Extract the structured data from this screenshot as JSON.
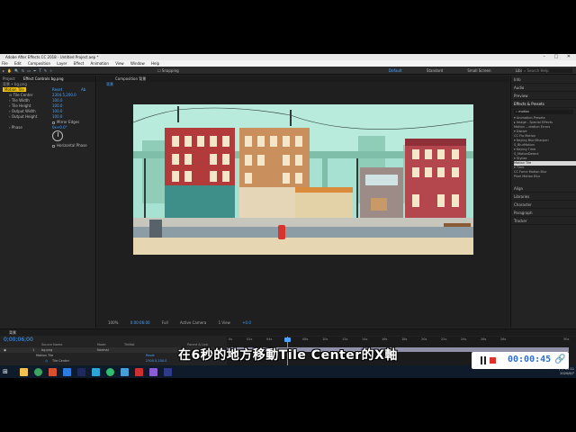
{
  "window": {
    "title": "Adobe After Effects CC 2018 - Untitled Project.aep *",
    "controls": "–  □  ✕"
  },
  "menu": [
    "File",
    "Edit",
    "Composition",
    "Layer",
    "Effect",
    "Animation",
    "View",
    "Window",
    "Help"
  ],
  "toolbar": {
    "snapping": "Snapping",
    "workspaces": [
      "Default",
      "Standard",
      "Small Screen",
      "Libraries"
    ],
    "active_workspace": "Default",
    "search_placeholder": "Search Help"
  },
  "project_panel": {
    "tabs": [
      "Project",
      "Effect Controls bg.png"
    ],
    "breadcrumb": "背景 • bg.png",
    "effect_name": "Motion Tile",
    "reset_label": "Reset",
    "about_label": "Ab",
    "properties": [
      {
        "name": "Tile Center",
        "value": "2304.5,200.0"
      },
      {
        "name": "Tile Width",
        "value": "100.0"
      },
      {
        "name": "Tile Height",
        "value": "100.0"
      },
      {
        "name": "Output Width",
        "value": "100.0"
      },
      {
        "name": "Output Height",
        "value": "100.0"
      }
    ],
    "mirror_edges": "Mirror Edges",
    "phase_label": "Phase",
    "phase_value": "0x+0.0°",
    "horizontal_phase": "Horizontal Phase"
  },
  "composition_panel": {
    "tab": "Composition 背景",
    "sub": "背景",
    "zoom": "100%",
    "timecode": "0:00:06:00",
    "resolution": "Full",
    "camera": "Active Camera",
    "views": "1 View",
    "exposure": "+0.0"
  },
  "right_panel": {
    "items_top": [
      "Info",
      "Audio",
      "Preview"
    ],
    "effects_title": "Effects & Presets",
    "search_value": "motion",
    "effects_tree": [
      "▾ Animation Presets",
      "  ▸ Image - Special Effects",
      "     Motion ...otation Errors",
      "▾ Distort",
      "     CC Flo Motion",
      "▾ Keying Blur/Sharpen",
      "     S_BlurMotion",
      "▾ Keying Time",
      "     S_MotionDetect",
      "▾ Stylize",
      "     Motion Tile",
      "▾ Time",
      "     CC Force Motion Blur",
      "     Pixel Motion Blur"
    ],
    "selected_effect": "Motion Tile",
    "items_bottom": [
      "Align",
      "Libraries",
      "Character",
      "Paragraph",
      "Tracker"
    ]
  },
  "timeline": {
    "tab": "背景",
    "timecode": "0;00;06;00",
    "columns": [
      "Source Name",
      "Mode",
      "TrkMat",
      "Parent & Link"
    ],
    "layer": {
      "index": "1",
      "name": "bg.png",
      "mode": "Normal",
      "parent": "None"
    },
    "effect_row": "Motion Tile",
    "effect_reset": "Reset",
    "property_row": "Tile Center",
    "property_value": "2304.5,200.0",
    "ruler": [
      "0s",
      "02s",
      "04s",
      "06s",
      "08s",
      "10s",
      "12s",
      "14s",
      "16s",
      "18s",
      "20s",
      "22s",
      "24s",
      "26s",
      "28s",
      "30s"
    ]
  },
  "taskbar": {
    "time": "下午 05:11",
    "date": "2020/6/7"
  },
  "subtitle": "在6秒的地方移動Tile Center的X軸",
  "recorder": {
    "elapsed": "00:00:45"
  },
  "colors": {
    "accent_blue": "#4aa3ff",
    "panel_bg": "#232323",
    "recorder_stop": "#e0322c"
  }
}
